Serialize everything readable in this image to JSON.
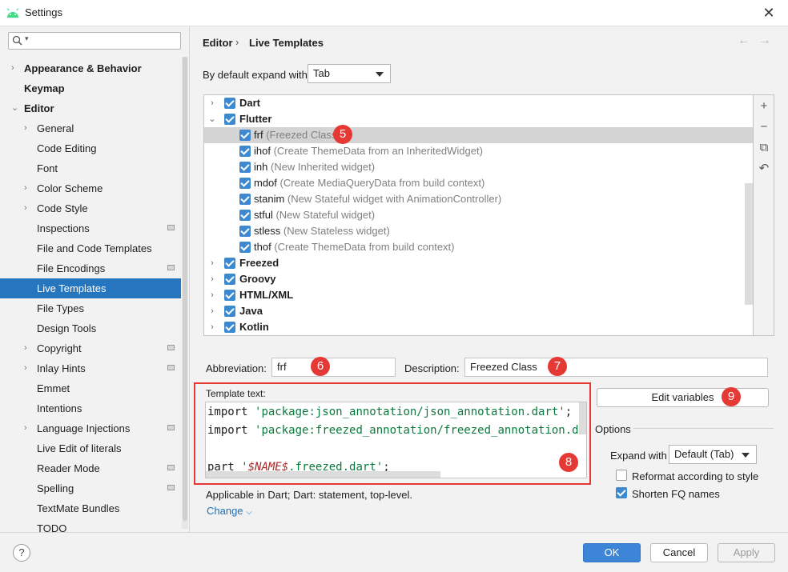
{
  "window": {
    "title": "Settings",
    "app_icon": "android-icon"
  },
  "search": {
    "placeholder": ""
  },
  "sidebar": {
    "items": [
      {
        "label": "Appearance & Behavior",
        "bold": true,
        "arrow": "›",
        "indent": 0
      },
      {
        "label": "Keymap",
        "bold": true,
        "arrow": "",
        "indent": 0
      },
      {
        "label": "Editor",
        "bold": true,
        "arrow": "⌄",
        "indent": 0
      },
      {
        "label": "General",
        "arrow": "›",
        "indent": 1
      },
      {
        "label": "Code Editing",
        "arrow": "",
        "indent": 1
      },
      {
        "label": "Font",
        "arrow": "",
        "indent": 1
      },
      {
        "label": "Color Scheme",
        "arrow": "›",
        "indent": 1
      },
      {
        "label": "Code Style",
        "arrow": "›",
        "indent": 1
      },
      {
        "label": "Inspections",
        "arrow": "",
        "indent": 1,
        "badge": true
      },
      {
        "label": "File and Code Templates",
        "arrow": "",
        "indent": 1
      },
      {
        "label": "File Encodings",
        "arrow": "",
        "indent": 1,
        "badge": true
      },
      {
        "label": "Live Templates",
        "arrow": "",
        "indent": 1,
        "selected": true
      },
      {
        "label": "File Types",
        "arrow": "",
        "indent": 1
      },
      {
        "label": "Design Tools",
        "arrow": "",
        "indent": 1
      },
      {
        "label": "Copyright",
        "arrow": "›",
        "indent": 1,
        "badge": true
      },
      {
        "label": "Inlay Hints",
        "arrow": "›",
        "indent": 1,
        "badge": true
      },
      {
        "label": "Emmet",
        "arrow": "",
        "indent": 1
      },
      {
        "label": "Intentions",
        "arrow": "",
        "indent": 1
      },
      {
        "label": "Language Injections",
        "arrow": "›",
        "indent": 1,
        "badge": true
      },
      {
        "label": "Live Edit of literals",
        "arrow": "",
        "indent": 1
      },
      {
        "label": "Reader Mode",
        "arrow": "",
        "indent": 1,
        "badge": true
      },
      {
        "label": "Spelling",
        "arrow": "",
        "indent": 1,
        "badge": true
      },
      {
        "label": "TextMate Bundles",
        "arrow": "",
        "indent": 1
      },
      {
        "label": "TODO",
        "arrow": "",
        "indent": 1
      }
    ]
  },
  "breadcrumb": {
    "parent": "Editor",
    "separator": "›",
    "current": "Live Templates"
  },
  "nav": {
    "back": "←",
    "forward": "→"
  },
  "expand_default": {
    "label": "By default expand with",
    "value": "Tab"
  },
  "template_rows": [
    {
      "kind": "group",
      "arrow": "›",
      "name": "Dart",
      "checked": true
    },
    {
      "kind": "group",
      "arrow": "⌄",
      "name": "Flutter",
      "checked": true
    },
    {
      "kind": "item",
      "name": "frf",
      "desc": "(Freezed Class)",
      "checked": true,
      "selected": true
    },
    {
      "kind": "item",
      "name": "ihof",
      "desc": "(Create ThemeData from an InheritedWidget)",
      "checked": true
    },
    {
      "kind": "item",
      "name": "inh",
      "desc": "(New Inherited widget)",
      "checked": true
    },
    {
      "kind": "item",
      "name": "mdof",
      "desc": "(Create MediaQueryData from build context)",
      "checked": true
    },
    {
      "kind": "item",
      "name": "stanim",
      "desc": "(New Stateful widget with AnimationController)",
      "checked": true
    },
    {
      "kind": "item",
      "name": "stful",
      "desc": "(New Stateful widget)",
      "checked": true
    },
    {
      "kind": "item",
      "name": "stless",
      "desc": "(New Stateless widget)",
      "checked": true
    },
    {
      "kind": "item",
      "name": "thof",
      "desc": "(Create ThemeData from build context)",
      "checked": true
    },
    {
      "kind": "group",
      "arrow": "›",
      "name": "Freezed",
      "checked": true
    },
    {
      "kind": "group",
      "arrow": "›",
      "name": "Groovy",
      "checked": true
    },
    {
      "kind": "group",
      "arrow": "›",
      "name": "HTML/XML",
      "checked": true
    },
    {
      "kind": "group",
      "arrow": "›",
      "name": "Java",
      "checked": true
    },
    {
      "kind": "group",
      "arrow": "›",
      "name": "Kotlin",
      "checked": true
    }
  ],
  "list_tools": [
    {
      "icon": "add-icon",
      "glyph": "+"
    },
    {
      "icon": "remove-icon",
      "glyph": "−"
    },
    {
      "icon": "copy-icon",
      "glyph": "⧉"
    },
    {
      "icon": "restore-icon",
      "glyph": "↶"
    }
  ],
  "abbreviation": {
    "label": "Abbreviation:",
    "value": "frf"
  },
  "description": {
    "label": "Description:",
    "value": "Freezed Class"
  },
  "template_text": {
    "label": "Template text:",
    "lines": [
      {
        "kw": "import ",
        "str": "'package:json_annotation/json_annotation.dart'",
        "rest": ";"
      },
      {
        "kw": "import ",
        "str": "'package:freezed_annotation/freezed_annotation.dart'",
        "rest": ";"
      },
      {
        "kw": "",
        "str": "",
        "rest": ""
      },
      {
        "kw": "part ",
        "str_open": "'",
        "var": "$NAME$",
        "str_close": ".freezed.dart'",
        "rest": ";"
      }
    ]
  },
  "applicable": {
    "text": "Applicable in Dart; Dart: statement, top-level.",
    "change": "Change"
  },
  "edit_variables": "Edit variables",
  "options": {
    "title": "Options",
    "expand_label": "Expand with",
    "expand_value": "Default (Tab)",
    "reformat": {
      "label": "Reformat according to style",
      "checked": false
    },
    "shorten": {
      "label": "Shorten FQ names",
      "checked": true
    }
  },
  "markers": [
    "5",
    "6",
    "7",
    "8",
    "9"
  ],
  "footer": {
    "help": "?",
    "ok": "OK",
    "cancel": "Cancel",
    "apply": "Apply"
  },
  "colors": {
    "accent": "#2675bf",
    "marker": "#e53935",
    "check": "#3c89d0"
  }
}
